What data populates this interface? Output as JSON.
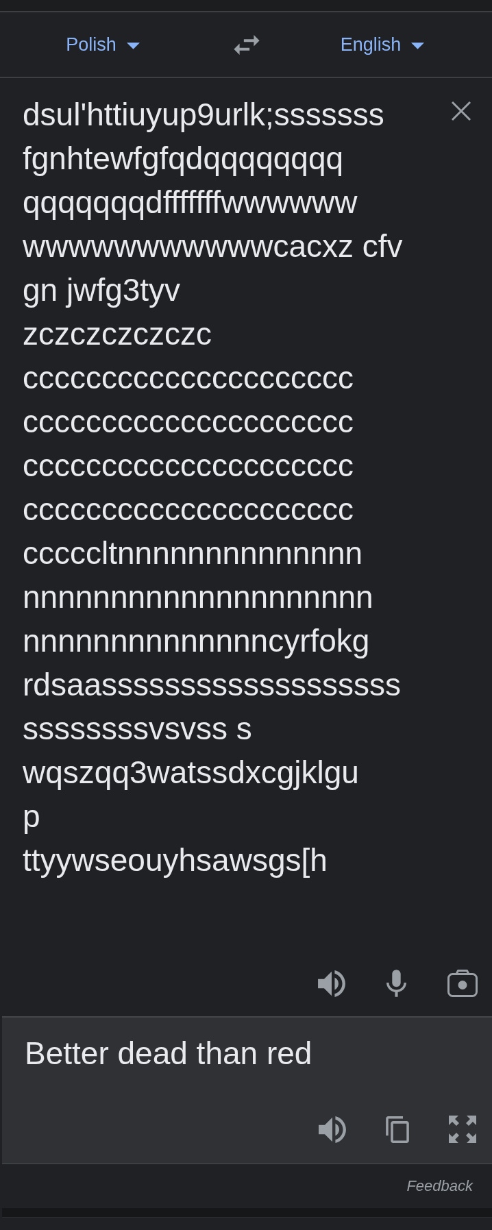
{
  "language_bar": {
    "source_language": "Polish",
    "target_language": "English"
  },
  "source_input": {
    "value": "dsul'httiuyup9urlk;sssssss\nfgnhtewfgfqdqqqqqqqq\nqqqqqqqdfffffffwwwwww\nwwwwwwwwwwwcacxz cfv\ngn jwfg3tyv\nzczczczczczc\nccccccccccccccccccccc\nccccccccccccccccccccc\nccccccccccccccccccccc\nccccccccccccccccccccc\ncccccltnnnnnnnnnnnnnn\nnnnnnnnnnnnnnnnnnnnn\nnnnnnnnnnnnnnncyrfokg\nrdsaasssssssssssssssssss\nssssssssvsvss s\nwqszqq3watssdxcgjklgu\np\nttyywseouyhsawsgs[h"
  },
  "translation": {
    "text": "Better dead than red"
  },
  "footer": {
    "feedback_link": "Feedback"
  }
}
